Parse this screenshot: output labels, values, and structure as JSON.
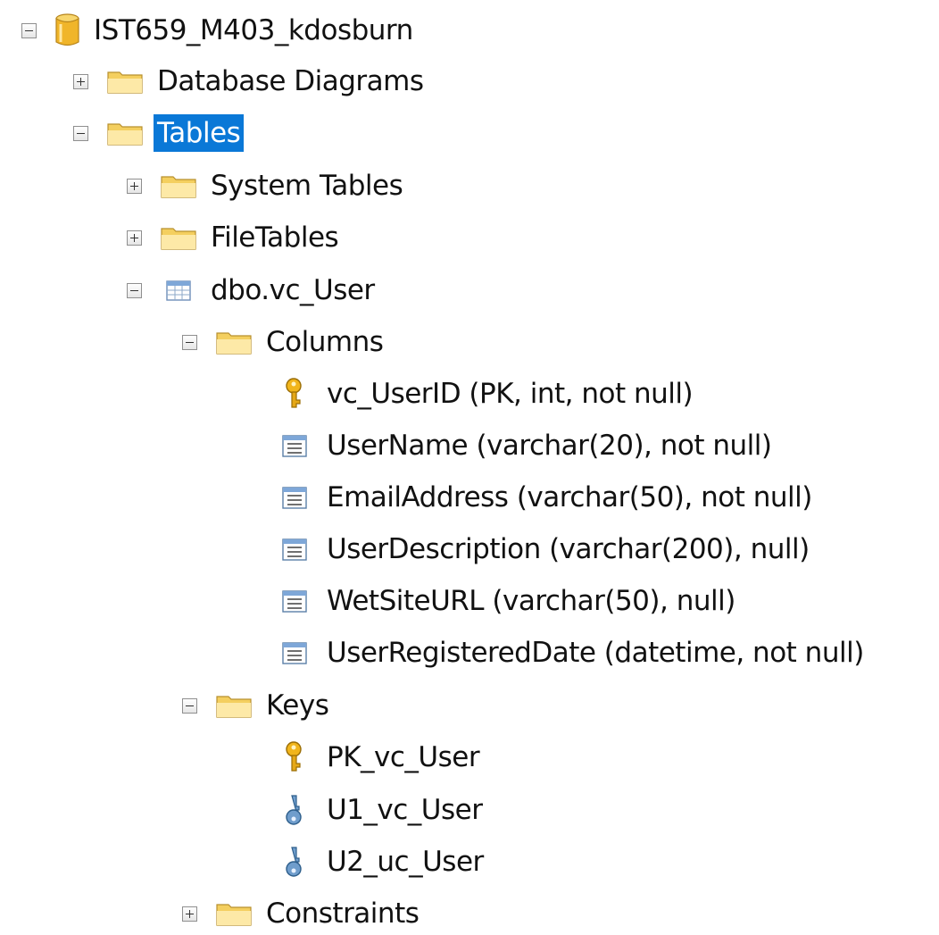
{
  "tree": {
    "database": {
      "label": "IST659_M403_kdosburn",
      "icon": "database-icon"
    },
    "database_diagrams": {
      "label": "Database Diagrams",
      "icon": "folder-icon"
    },
    "tables": {
      "label": "Tables",
      "icon": "folder-icon"
    },
    "system_tables": {
      "label": "System Tables",
      "icon": "folder-icon"
    },
    "file_tables": {
      "label": "FileTables",
      "icon": "folder-icon"
    },
    "table_vc_user": {
      "label": "dbo.vc_User",
      "icon": "table-icon"
    },
    "columns": {
      "label": "Columns",
      "icon": "folder-icon",
      "items": [
        {
          "label": "vc_UserID (PK, int, not null)",
          "icon": "primary-key-icon"
        },
        {
          "label": "UserName (varchar(20), not null)",
          "icon": "column-icon"
        },
        {
          "label": "EmailAddress (varchar(50), not null)",
          "icon": "column-icon"
        },
        {
          "label": "UserDescription (varchar(200), null)",
          "icon": "column-icon"
        },
        {
          "label": "WetSiteURL (varchar(50), null)",
          "icon": "column-icon"
        },
        {
          "label": "UserRegisteredDate (datetime, not null)",
          "icon": "column-icon"
        }
      ]
    },
    "keys": {
      "label": "Keys",
      "icon": "folder-icon",
      "items": [
        {
          "label": "PK_vc_User",
          "icon": "primary-key-icon"
        },
        {
          "label": "U1_vc_User",
          "icon": "unique-key-icon"
        },
        {
          "label": "U2_uc_User",
          "icon": "unique-key-icon"
        }
      ]
    },
    "constraints": {
      "label": "Constraints",
      "icon": "folder-icon"
    }
  },
  "colors": {
    "selection": "#0a78d7",
    "folder": "#f2c94c",
    "database": "#f0b52a",
    "key_gold": "#e5a817",
    "key_blue": "#5f8fbe"
  }
}
